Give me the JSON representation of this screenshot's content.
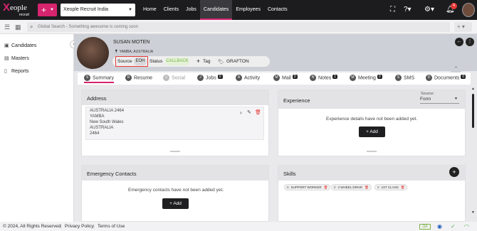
{
  "topbar": {
    "logo_letter": "X",
    "logo_word": "eople",
    "logo_sub": "recruit",
    "company": "Xeople Recruit India",
    "nav": [
      "Home",
      "Clients",
      "Jobs",
      "Candidates",
      "Employees",
      "Contacts"
    ],
    "active_nav": "Candidates",
    "notification_count": "4"
  },
  "search": {
    "placeholder": "Global Search - Something awesome is coming soon"
  },
  "sidebar": {
    "items": [
      "Candidates",
      "Masters",
      "Reports"
    ]
  },
  "profile": {
    "name": "SUSAN MOTEN",
    "location": "YAMBA, AUSTRALIA",
    "source_label": "Source",
    "source_value": "EOH",
    "status_label": "Status",
    "status_value": "CALLBACK",
    "tag_label": "Tag",
    "tag_value": "GRAFTON"
  },
  "tabs": [
    {
      "label": "Summary",
      "count": ""
    },
    {
      "label": "Resume",
      "count": ""
    },
    {
      "label": "Social",
      "count": ""
    },
    {
      "label": "Jobs",
      "count": "0"
    },
    {
      "label": "Activity",
      "count": ""
    },
    {
      "label": "Mail",
      "count": "0"
    },
    {
      "label": "Notes",
      "count": "1"
    },
    {
      "label": "Meeting",
      "count": "0"
    },
    {
      "label": "SMS",
      "count": ""
    },
    {
      "label": "Documents",
      "count": "0"
    }
  ],
  "address": {
    "title": "Address",
    "lines": [
      "AUSTRALIA 2464",
      "YAMBA",
      "New South Wales",
      "AUSTRALIA",
      "2464"
    ]
  },
  "experience": {
    "title": "Experience",
    "source_label": "Source:",
    "source_value": "Form",
    "empty_text": "Experience details have not been added yet.",
    "add_label": "Add"
  },
  "emergency": {
    "title": "Emergency Contacts",
    "empty_text": "Emergency contacts have not been added yet.",
    "add_label": "Add"
  },
  "skills": {
    "title": "Skills",
    "items": [
      {
        "count": "0",
        "label": "SUPPORT WORKER"
      },
      {
        "count": "0",
        "label": "4 WHEEL DRIVE"
      },
      {
        "count": "0",
        "label": "1ST CLASS"
      }
    ]
  },
  "footer": {
    "copyright": "© 2024, All Rights Reserved",
    "privacy": "Privacy Policy",
    "terms": "Terms of Use",
    "env": "QA"
  }
}
